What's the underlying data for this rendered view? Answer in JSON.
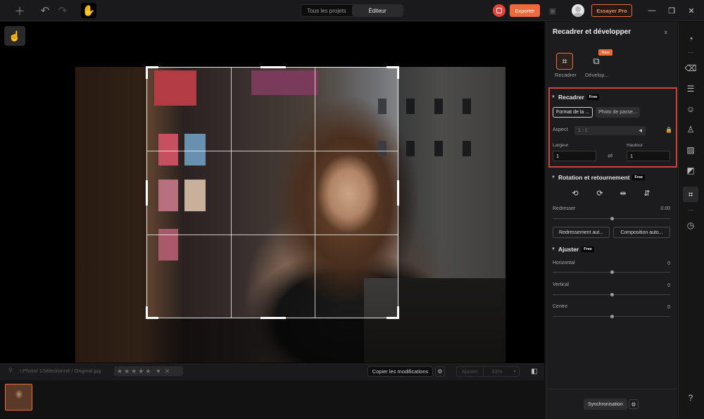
{
  "topbar": {
    "tabs": [
      "Tous les projets",
      "Éditeur"
    ],
    "active_tab": "Éditeur",
    "export_label": "Exporter",
    "pro_label": "Essayer Pro",
    "icons": [
      "add-icon",
      "undo-icon",
      "redo-icon",
      "hand-icon",
      "record-icon",
      "share-icon",
      "avatar",
      "minimize-icon",
      "restore-icon",
      "close-icon"
    ]
  },
  "canvas": {
    "crop_aspect": "1 : 1"
  },
  "bottombar": {
    "path": "I:Photo/ 1Sélectionné / Original.jpg",
    "rating_stars": 5,
    "copy_label": "Copier les modifications",
    "fit_label": "Ajuster",
    "zoom_label": "33%"
  },
  "panel": {
    "title": "Recadrer et développer",
    "modes": [
      {
        "label": "Recadrer",
        "icon": "crop-icon"
      },
      {
        "label": "Dévelop...",
        "icon": "develop-icon",
        "badge": "New"
      }
    ],
    "free_badge": "Free",
    "recadrer": {
      "title": "Recadrer",
      "format_btn": "Format de la ...",
      "passport_btn": "Photo de passe...",
      "aspect_label": "Aspect",
      "aspect_value": "1 : 1",
      "width_label": "Largeur",
      "height_label": "Hauteur",
      "width_value": "1",
      "height_value": "1"
    },
    "rotation": {
      "title": "Rotation et retournement",
      "straighten_label": "Redresser",
      "straighten_value": "0.00",
      "auto_straighten_btn": "Redressement aut...",
      "auto_compose_btn": "Composition auto..."
    },
    "ajuster": {
      "title": "Ajuster",
      "horizontal_label": "Horizontal",
      "horizontal_value": "0",
      "vertical_label": "Vertical",
      "vertical_value": "0",
      "centre_label": "Centre",
      "centre_value": "0"
    },
    "sync_label": "Synchronisation"
  },
  "colors": {
    "accent": "#ee6a3d",
    "highlight_box": "#c8453a",
    "background": "#0f0f10"
  }
}
